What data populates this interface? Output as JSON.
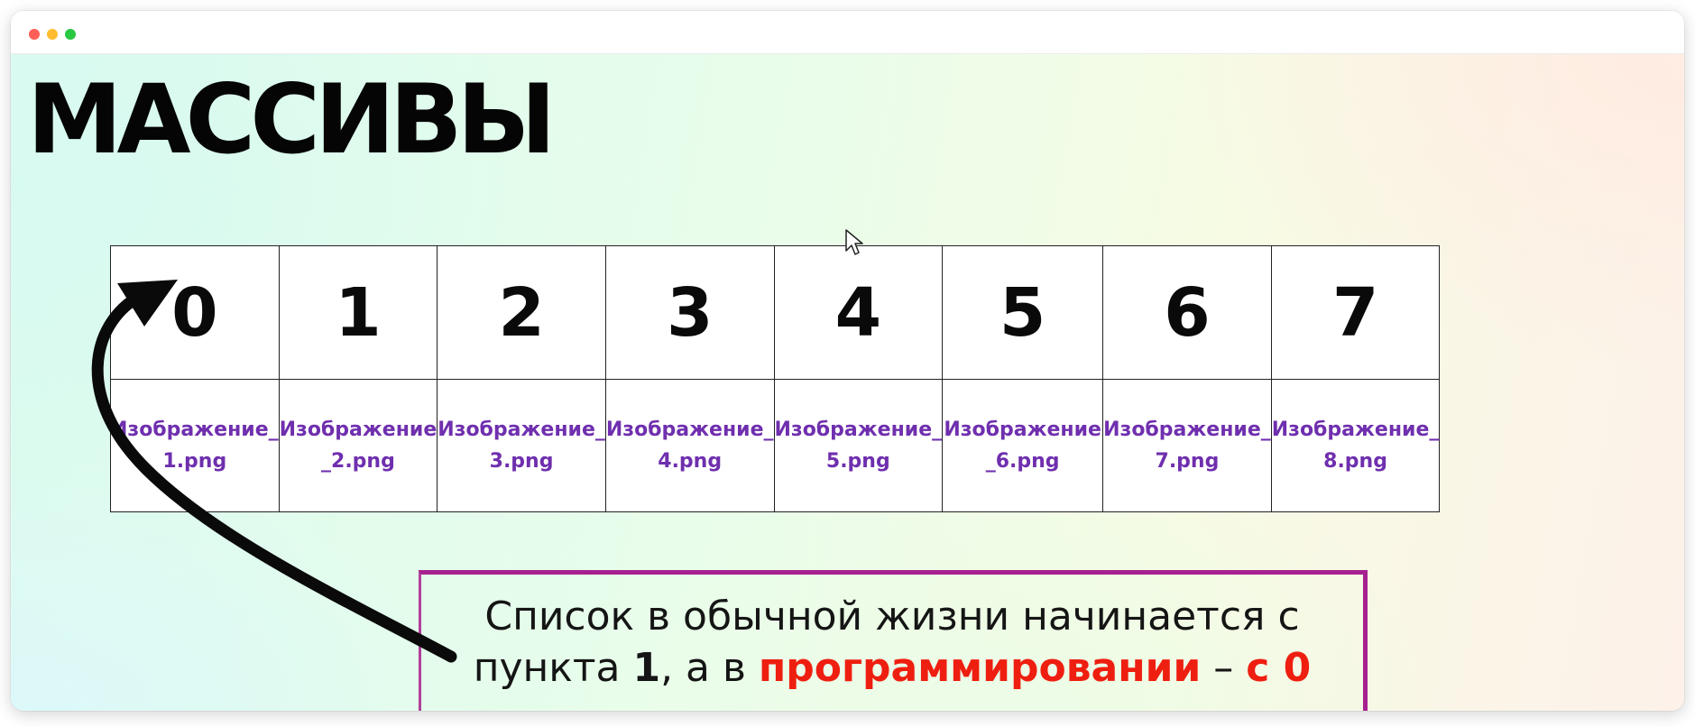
{
  "window": {
    "controls": [
      "close",
      "minimize",
      "zoom"
    ]
  },
  "slide": {
    "title": "МАССИВЫ",
    "indices": [
      "0",
      "1",
      "2",
      "3",
      "4",
      "5",
      "6",
      "7"
    ],
    "items": [
      [
        "Изображение_",
        "1.png"
      ],
      [
        "Изображение",
        "_2.png"
      ],
      [
        "Изображение_",
        "3.png"
      ],
      [
        "Изображение_",
        "4.png"
      ],
      [
        "Изображение_",
        "5.png"
      ],
      [
        "Изображение",
        "_6.png"
      ],
      [
        "Изображение_",
        "7.png"
      ],
      [
        "Изображение_",
        "8.png"
      ]
    ],
    "callout": {
      "line1": "Список в обычной жизни начинается с",
      "line2_prefix": "пункта ",
      "line2_bold": "1",
      "line2_mid": ", а в ",
      "line2_red1": "программировании",
      "line2_dash": " – ",
      "line2_red2": "с 0"
    }
  },
  "colors": {
    "index_text": "#0a0a0a",
    "item_text": "#6f2fae",
    "callout_border": "#a6218f",
    "highlight_red": "#ee1f10",
    "arrow": "#0a0a0a"
  },
  "icons": {
    "pointer": "mouse-cursor-icon",
    "arrow": "curved-arrow-icon"
  }
}
